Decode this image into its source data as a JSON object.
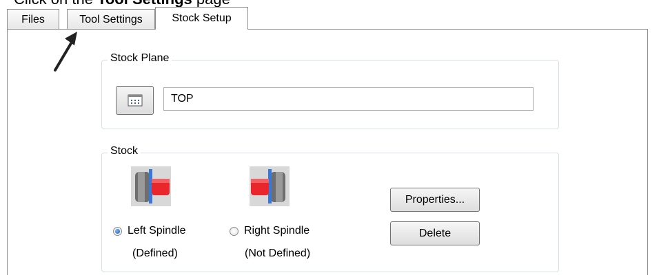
{
  "clipped_heading": {
    "prefix": "Click on the ",
    "bold": "Tool Settings",
    "suffix": " page"
  },
  "tabs": [
    {
      "label": "Files"
    },
    {
      "label": "Tool Settings"
    },
    {
      "label": "Stock Setup",
      "active": true
    }
  ],
  "stock_plane": {
    "legend": "Stock Plane",
    "button_icon": "plane-select-icon",
    "value": "TOP"
  },
  "stock": {
    "legend": "Stock",
    "left": {
      "icon": "left-spindle-icon",
      "label": "Left Spindle",
      "status": "(Defined)",
      "selected": true
    },
    "right": {
      "icon": "right-spindle-icon",
      "label": "Right Spindle",
      "status": "(Not Defined)",
      "selected": false
    },
    "properties_label": "Properties...",
    "delete_label": "Delete"
  },
  "colors": {
    "stock_red": "#e8262b",
    "chuck_gray": "#8a8a8a",
    "spindle_blue": "#3a78d8",
    "group_border": "#d5dfe5"
  }
}
